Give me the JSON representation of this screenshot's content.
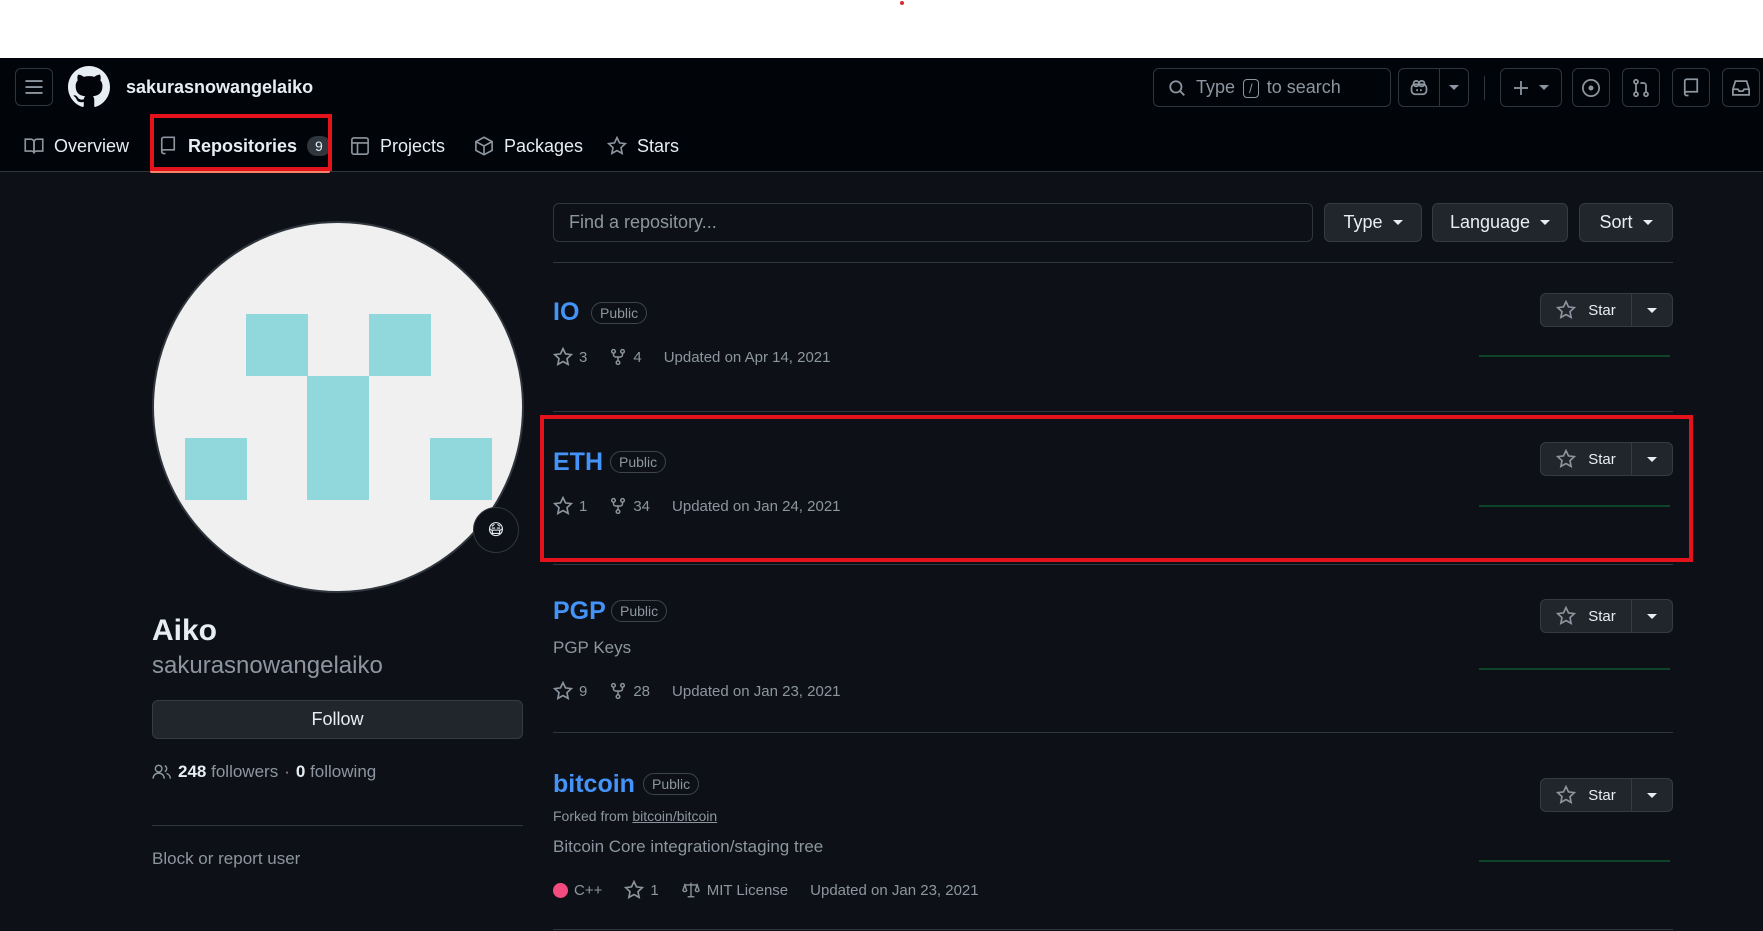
{
  "header": {
    "username": "sakurasnowangelaiko",
    "search": {
      "pre": "Type",
      "key": "/",
      "post": "to search"
    }
  },
  "tabs": [
    {
      "label": "Overview"
    },
    {
      "label": "Repositories",
      "count": "9"
    },
    {
      "label": "Projects"
    },
    {
      "label": "Packages"
    },
    {
      "label": "Stars"
    }
  ],
  "profile": {
    "display_name": "Aiko",
    "login": "sakurasnowangelaiko",
    "follow_label": "Follow",
    "followers_count": "248",
    "followers_label": "followers",
    "dot": "·",
    "following_count": "0",
    "following_label": "following",
    "block_label": "Block or report user",
    "status_emoji": "😷"
  },
  "filters": {
    "find_placeholder": "Find a repository...",
    "type": "Type",
    "language": "Language",
    "sort": "Sort"
  },
  "star_label": "Star",
  "repos": [
    {
      "name": "IO",
      "visibility": "Public",
      "stars": "3",
      "forks": "4",
      "updated": "Updated on Apr 14, 2021"
    },
    {
      "name": "ETH",
      "visibility": "Public",
      "stars": "1",
      "forks": "34",
      "updated": "Updated on Jan 24, 2021"
    },
    {
      "name": "PGP",
      "visibility": "Public",
      "description": "PGP Keys",
      "stars": "9",
      "forks": "28",
      "updated": "Updated on Jan 23, 2021"
    },
    {
      "name": "bitcoin",
      "visibility": "Public",
      "forked_prefix": "Forked from",
      "forked_from": "bitcoin/bitcoin",
      "description": "Bitcoin Core integration/staging tree",
      "language": "C++",
      "language_color": "#f34b7d",
      "stars": "1",
      "license": "MIT License",
      "updated": "Updated on Jan 23, 2021"
    }
  ],
  "colors": {
    "accent_link": "#4493f8",
    "highlight": "#e3121b",
    "background": "#0d1117",
    "header": "#010409"
  }
}
